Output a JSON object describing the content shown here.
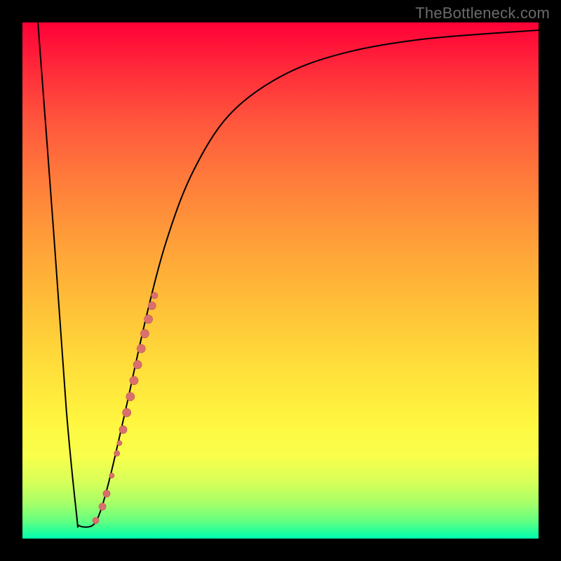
{
  "watermark": "TheBottleneck.com",
  "colors": {
    "curve_stroke": "#000000",
    "marker_fill": "#d9706d",
    "marker_stroke": "#c85f5c",
    "frame": "#000000"
  },
  "chart_data": {
    "type": "line",
    "title": "",
    "xlabel": "",
    "ylabel": "",
    "xlim": [
      0,
      100
    ],
    "ylim": [
      0,
      100
    ],
    "grid": false,
    "curve": {
      "comment": "y expressed as percentage of plot height from top (0=top, 100=bottom). Piecewise: steep descent, flat valley, saturating rise.",
      "points": [
        {
          "x": 3.0,
          "y": 0.0
        },
        {
          "x": 6.0,
          "y": 40.0
        },
        {
          "x": 8.5,
          "y": 75.0
        },
        {
          "x": 10.5,
          "y": 95.5
        },
        {
          "x": 11.0,
          "y": 97.5
        },
        {
          "x": 13.5,
          "y": 97.5
        },
        {
          "x": 15.0,
          "y": 95.0
        },
        {
          "x": 17.0,
          "y": 88.0
        },
        {
          "x": 20.0,
          "y": 75.0
        },
        {
          "x": 24.0,
          "y": 57.0
        },
        {
          "x": 28.0,
          "y": 42.0
        },
        {
          "x": 33.0,
          "y": 29.0
        },
        {
          "x": 40.0,
          "y": 18.0
        },
        {
          "x": 50.0,
          "y": 10.5
        },
        {
          "x": 62.0,
          "y": 6.0
        },
        {
          "x": 78.0,
          "y": 3.2
        },
        {
          "x": 100.0,
          "y": 1.5
        }
      ]
    },
    "markers": {
      "comment": "Pink dots along the rising limb near the valley; r is radius in px at 736x736 plot.",
      "points": [
        {
          "x": 14.2,
          "y": 96.5,
          "r": 4.5
        },
        {
          "x": 15.5,
          "y": 93.8,
          "r": 5.0
        },
        {
          "x": 16.3,
          "y": 91.3,
          "r": 5.0
        },
        {
          "x": 17.3,
          "y": 87.8,
          "r": 3.5
        },
        {
          "x": 18.3,
          "y": 83.5,
          "r": 4.0
        },
        {
          "x": 18.8,
          "y": 81.5,
          "r": 3.5
        },
        {
          "x": 19.5,
          "y": 78.9,
          "r": 5.5
        },
        {
          "x": 20.2,
          "y": 75.6,
          "r": 6.0
        },
        {
          "x": 20.9,
          "y": 72.5,
          "r": 6.0
        },
        {
          "x": 21.6,
          "y": 69.4,
          "r": 6.0
        },
        {
          "x": 22.3,
          "y": 66.3,
          "r": 6.0
        },
        {
          "x": 23.0,
          "y": 63.2,
          "r": 6.0
        },
        {
          "x": 23.7,
          "y": 60.3,
          "r": 6.0
        },
        {
          "x": 24.4,
          "y": 57.5,
          "r": 6.0
        },
        {
          "x": 25.1,
          "y": 54.9,
          "r": 5.5
        },
        {
          "x": 25.6,
          "y": 52.9,
          "r": 4.5
        }
      ]
    }
  }
}
